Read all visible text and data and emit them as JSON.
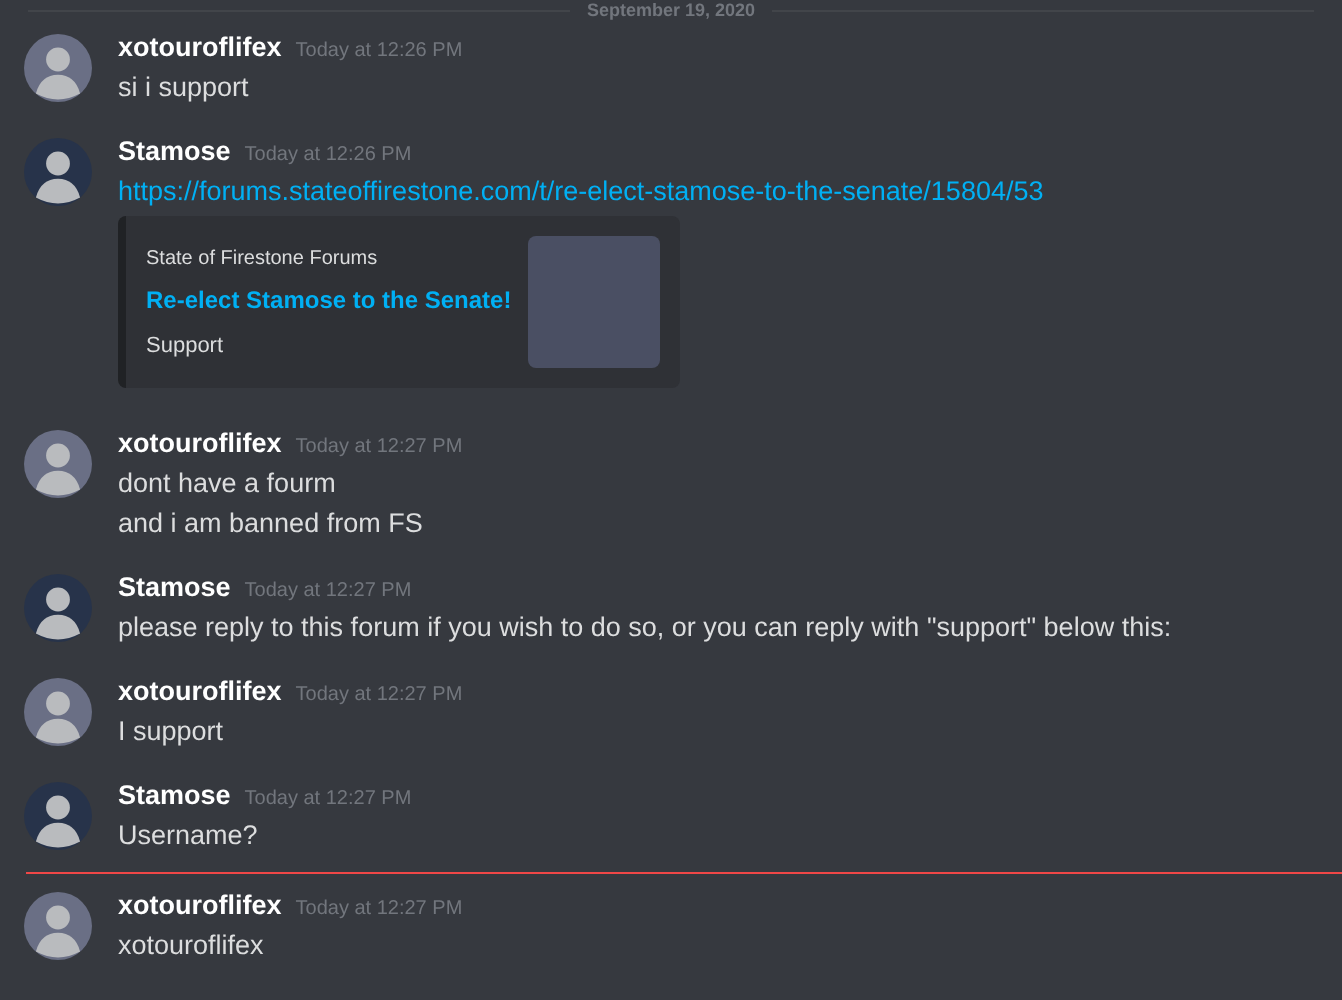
{
  "date_divider": "September 19, 2020",
  "messages": [
    {
      "author": "xotouroflifex",
      "color": "#6a6f85",
      "time": "Today at 12:26 PM",
      "new_messages_divider": false,
      "lines": [
        {
          "kind": "text",
          "text": "si i support"
        }
      ]
    },
    {
      "author": "Stamose",
      "color": "#27334a",
      "time": "Today at 12:26 PM",
      "new_messages_divider": false,
      "lines": [
        {
          "kind": "link",
          "text": "https://forums.stateoffirestone.com/t/re-elect-stamose-to-the-senate/15804/53"
        },
        {
          "kind": "embed",
          "provider": "State of Firestone Forums",
          "title": "Re-elect Stamose to the Senate!",
          "description": "Support"
        }
      ]
    },
    {
      "author": "xotouroflifex",
      "color": "#6a6f85",
      "time": "Today at 12:27 PM",
      "new_messages_divider": false,
      "lines": [
        {
          "kind": "text",
          "text": "dont have a fourm"
        },
        {
          "kind": "text",
          "text": "and i am banned from FS"
        }
      ]
    },
    {
      "author": "Stamose",
      "color": "#27334a",
      "time": "Today at 12:27 PM",
      "new_messages_divider": false,
      "lines": [
        {
          "kind": "text",
          "text": "please reply to this forum if you wish to do so, or you can reply with \"support\" below this:"
        }
      ]
    },
    {
      "author": "xotouroflifex",
      "color": "#6a6f85",
      "time": "Today at 12:27 PM",
      "new_messages_divider": false,
      "lines": [
        {
          "kind": "text",
          "text": "I support"
        }
      ]
    },
    {
      "author": "Stamose",
      "color": "#27334a",
      "time": "Today at 12:27 PM",
      "new_messages_divider": false,
      "lines": [
        {
          "kind": "text",
          "text": "Username?"
        }
      ]
    },
    {
      "author": "xotouroflifex",
      "color": "#6a6f85",
      "time": "Today at 12:27 PM",
      "new_messages_divider": true,
      "lines": [
        {
          "kind": "text",
          "text": "xotouroflifex"
        }
      ]
    }
  ]
}
